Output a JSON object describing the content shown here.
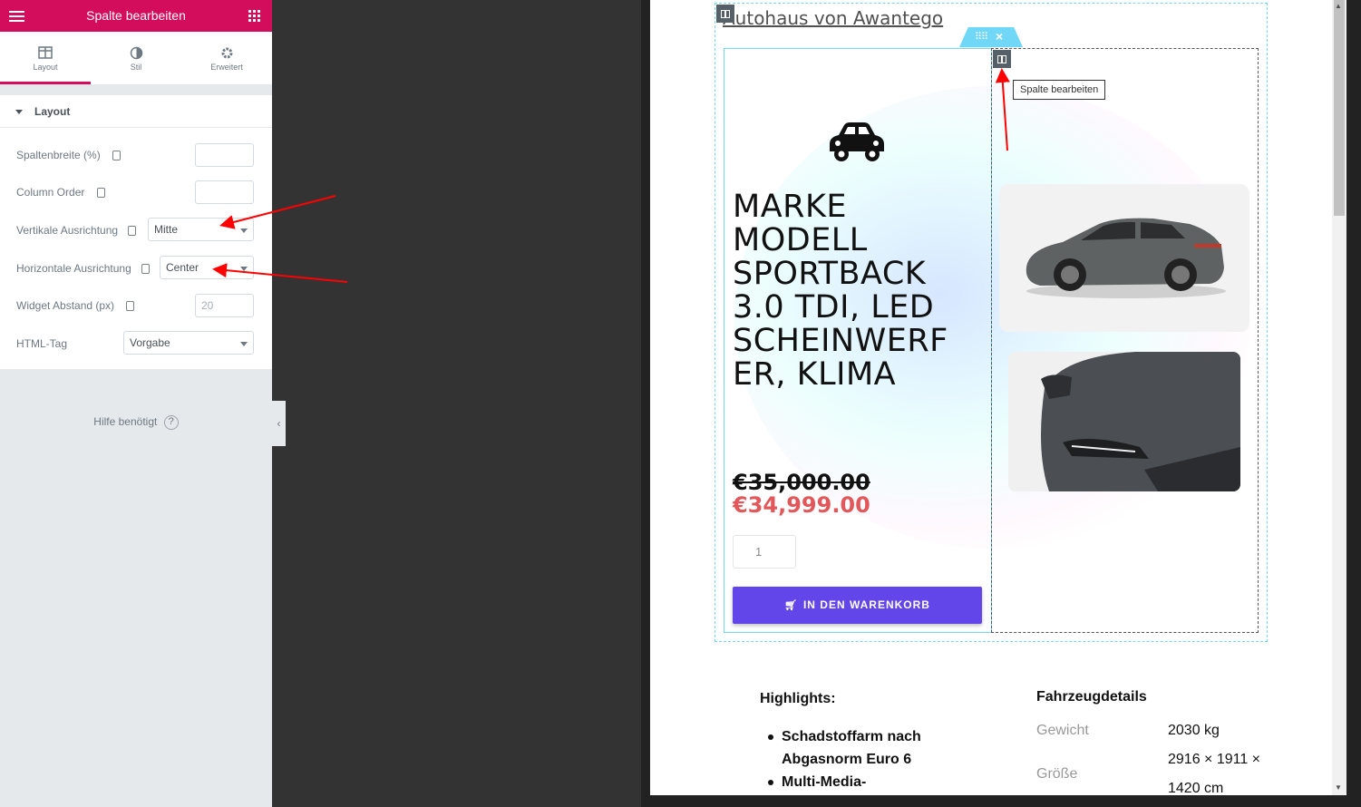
{
  "panel": {
    "title": "Spalte bearbeiten",
    "tabs": [
      {
        "label": "Layout"
      },
      {
        "label": "Stil"
      },
      {
        "label": "Erweitert"
      }
    ],
    "section_label": "Layout",
    "controls": {
      "column_width": {
        "label": "Spaltenbreite (%)",
        "value": ""
      },
      "column_order": {
        "label": "Column Order",
        "value": ""
      },
      "vertical_align": {
        "label": "Vertikale Ausrichtung",
        "value": "Mitte"
      },
      "horizontal_align": {
        "label": "Horizontale Ausrichtung",
        "value": "Center"
      },
      "widget_gap": {
        "label": "Widget Abstand (px)",
        "placeholder": "20"
      },
      "html_tag": {
        "label": "HTML-Tag",
        "value": "Vorgabe"
      }
    },
    "help": "Hilfe benötigt",
    "help_icon": "?"
  },
  "preview": {
    "site_title": "Autohaus von Awantego",
    "tooltip": "Spalte bearbeiten",
    "product_title": "MARKE MODELL SPORTBACK 3.0 TDI, LED SCHEINWERF ER, KLIMA",
    "price_old": "€35,000.00",
    "price_new": "€34,999.00",
    "quantity": "1",
    "add_to_cart": "IN DEN WARENKORB",
    "highlights_heading": "Highlights:",
    "highlights": [
      "Schadstoffarm nach Abgasnorm Euro 6",
      "Multi-Media-"
    ],
    "details_heading": "Fahrzeugdetails",
    "details": {
      "weight_label": "Gewicht",
      "weight_value": "2030 kg",
      "size_label": "Größe",
      "size_value": "2916 × 1911 × 1420 cm"
    }
  },
  "colors": {
    "brand": "#d30c5c",
    "editor_accent": "#71d7f7",
    "cart_button": "#6246ea",
    "sale_price": "#e2585a",
    "annotation_arrow": "#ff0000"
  }
}
